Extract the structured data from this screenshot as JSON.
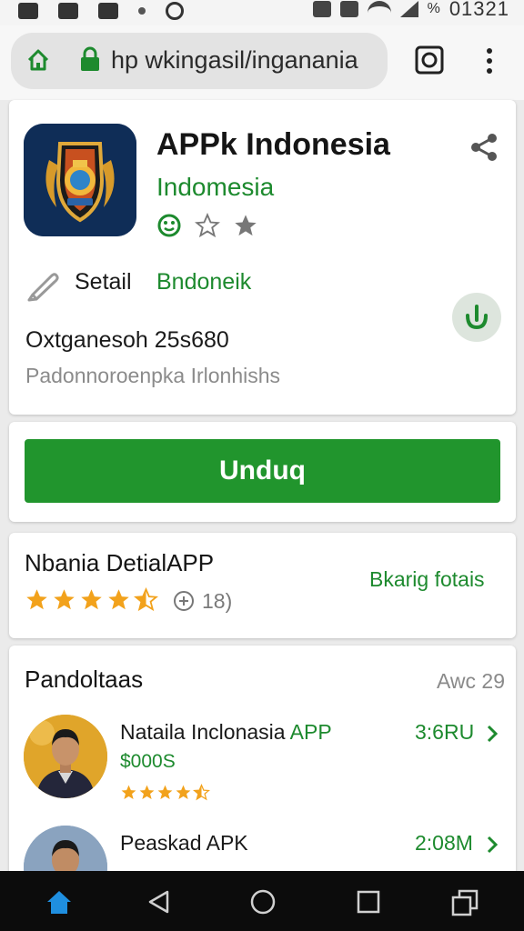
{
  "status_bar": {
    "battery_pct": "%",
    "time": "01321"
  },
  "browser": {
    "url": "hp wkingasil/inganania",
    "icons": [
      "home-icon",
      "lock-icon",
      "camera-icon",
      "menu-icon"
    ]
  },
  "app": {
    "title": "APPk Indonesia",
    "developer": "Indomesia",
    "detail_label": "Setail",
    "detail_value": "Bndoneik",
    "size_line": "Oxtganesoh 25s680",
    "description": "Padonnoroenpka Irlonhishs",
    "icons": [
      "share-icon",
      "smile-icon",
      "star-outline-icon",
      "star-grey-icon",
      "pencil-icon",
      "download-badge-icon"
    ]
  },
  "download": {
    "label": "Unduq",
    "color": "#21952d"
  },
  "details": {
    "title": "Nbania DetialAPP",
    "rating": 4.5,
    "count": "18)",
    "link": "Bkarig fotais"
  },
  "list": {
    "title": "Pandoltaas",
    "more": "Awc 29",
    "items": [
      {
        "name": "Nataila Inclonasia",
        "name_accent": " APP",
        "sub": "$000S",
        "size": "3:6RU",
        "rating": 4.5
      },
      {
        "name": "Peaskad APK",
        "sub": "",
        "size": "2:08M",
        "rating": 0
      }
    ]
  },
  "nav": {
    "icons": [
      "home-icon",
      "back-icon",
      "circle-home-icon",
      "square-recents-icon",
      "switch-icon"
    ]
  },
  "colors": {
    "accent_green": "#1d8a2e",
    "button_green": "#21952d",
    "star_orange": "#f2a21c"
  }
}
